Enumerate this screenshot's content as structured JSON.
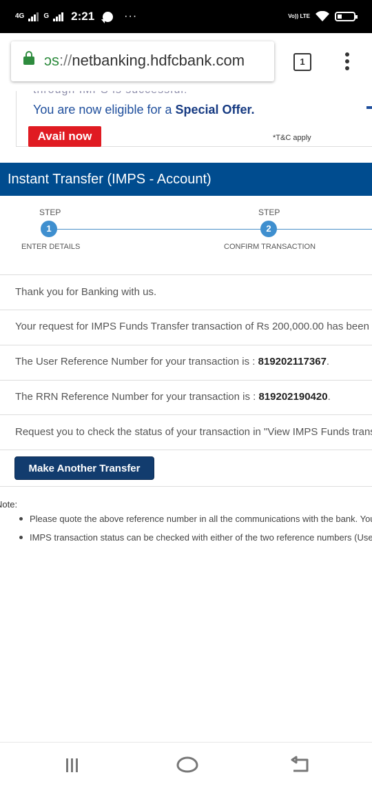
{
  "status_bar": {
    "net1": "4G",
    "net2": "G",
    "time": "2:21",
    "more": "···",
    "volte": "Vo)) LTE"
  },
  "browser": {
    "url_scheme": "ɔs",
    "url_sep": "://",
    "url_host": "netbanking.hdfcbank.com",
    "tab_count": "1"
  },
  "promo": {
    "cut_text": "through IMPS is successful!",
    "line_prefix": "You are now eligible for a ",
    "line_bold": "Special Offer.",
    "button": "Avail now",
    "tnc": "*T&C apply"
  },
  "page": {
    "title": "Instant Transfer (IMPS - Account)"
  },
  "stepper": {
    "steps": [
      {
        "label": "STEP",
        "number": "1",
        "caption": "ENTER DETAILS"
      },
      {
        "label": "STEP",
        "number": "2",
        "caption": "CONFIRM TRANSACTION"
      }
    ]
  },
  "messages": {
    "thanks": "Thank you for Banking with us.",
    "request": "Your request for IMPS Funds Transfer transaction of Rs 200,000.00 has been a",
    "user_ref_label": "The User Reference Number for your transaction is : ",
    "user_ref_value": "819202117367",
    "rrn_label": "The RRN Reference Number for your transaction is : ",
    "rrn_value": "819202190420",
    "check_status": "Request you to check the status of your transaction in \"View IMPS Funds trans"
  },
  "actions": {
    "make_another": "Make Another Transfer"
  },
  "note": {
    "label": "Note:",
    "items": [
      "Please quote the above reference number in all the communications with the bank. You",
      "IMPS transaction status can be checked with either of the two reference numbers (User"
    ]
  },
  "colors": {
    "header_blue": "#004c8f",
    "avail_red": "#e01b22",
    "step_blue": "#3f8fcf",
    "button_navy": "#123c6e",
    "lock_green": "#2e8b3e"
  },
  "icons": [
    "lock-icon",
    "tab-switcher-icon",
    "overflow-menu-icon",
    "wifi-icon",
    "battery-icon",
    "recent-apps-icon",
    "home-icon",
    "back-icon"
  ]
}
